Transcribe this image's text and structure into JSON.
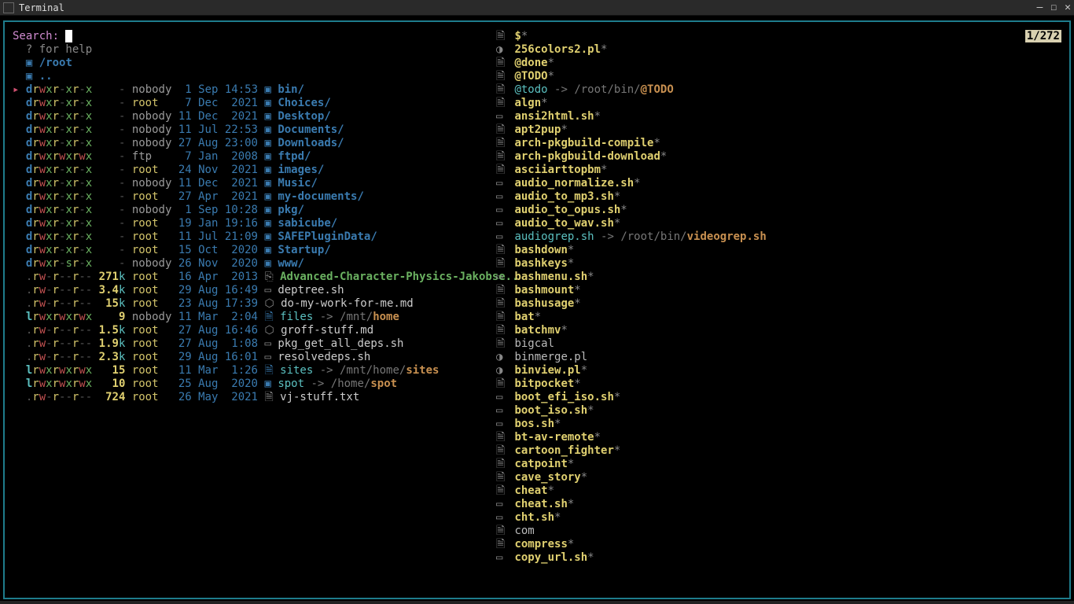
{
  "window": {
    "title": "Terminal"
  },
  "counter": "1/272",
  "search": {
    "label": "Search:",
    "help": "  ? for help"
  },
  "path": {
    "icon": "▣",
    "root": "/root",
    "up": ".."
  },
  "left_rows": [
    {
      "sel": true,
      "perm": "drwxr-xr-x",
      "size": "-",
      "user": "nobody",
      "date": " 1 Sep 14:53",
      "icon": "▣",
      "name": "bin/",
      "type": "dir"
    },
    {
      "sel": false,
      "perm": "drwxr-xr-x",
      "size": "-",
      "user": "root",
      "date": " 7 Dec  2021",
      "icon": "▣",
      "name": "Choices/",
      "type": "dir"
    },
    {
      "sel": false,
      "perm": "drwxr-xr-x",
      "size": "-",
      "user": "nobody",
      "date": "11 Dec  2021",
      "icon": "▣",
      "name": "Desktop/",
      "type": "dir"
    },
    {
      "sel": false,
      "perm": "drwxr-xr-x",
      "size": "-",
      "user": "nobody",
      "date": "11 Jul 22:53",
      "icon": "▣",
      "name": "Documents/",
      "type": "dir"
    },
    {
      "sel": false,
      "perm": "drwxr-xr-x",
      "size": "-",
      "user": "nobody",
      "date": "27 Aug 23:00",
      "icon": "▣",
      "name": "Downloads/",
      "type": "dir"
    },
    {
      "sel": false,
      "perm": "drwxrwxrwx",
      "size": "-",
      "user": "ftp",
      "date": " 7 Jan  2008",
      "icon": "▣",
      "name": "ftpd/",
      "type": "dir"
    },
    {
      "sel": false,
      "perm": "drwxr-xr-x",
      "size": "-",
      "user": "root",
      "date": "24 Nov  2021",
      "icon": "▣",
      "name": "images/",
      "type": "dir"
    },
    {
      "sel": false,
      "perm": "drwxr-xr-x",
      "size": "-",
      "user": "nobody",
      "date": "11 Dec  2021",
      "icon": "▣",
      "name": "Music/",
      "type": "dir"
    },
    {
      "sel": false,
      "perm": "drwxr-xr-x",
      "size": "-",
      "user": "root",
      "date": "27 Apr  2021",
      "icon": "▣",
      "name": "my-documents/",
      "type": "dir"
    },
    {
      "sel": false,
      "perm": "drwxr-xr-x",
      "size": "-",
      "user": "nobody",
      "date": " 1 Sep 10:28",
      "icon": "▣",
      "name": "pkg/",
      "type": "dir"
    },
    {
      "sel": false,
      "perm": "drwxr-xr-x",
      "size": "-",
      "user": "root",
      "date": "19 Jan 19:16",
      "icon": "▣",
      "name": "sabicube/",
      "type": "dir"
    },
    {
      "sel": false,
      "perm": "drwxr-xr-x",
      "size": "-",
      "user": "root",
      "date": "11 Jul 21:09",
      "icon": "▣",
      "name": "SAFEPluginData/",
      "type": "dir"
    },
    {
      "sel": false,
      "perm": "drwxr-xr-x",
      "size": "-",
      "user": "root",
      "date": "15 Oct  2020",
      "icon": "▣",
      "name": "Startup/",
      "type": "dir"
    },
    {
      "sel": false,
      "perm": "drwxr-sr-x",
      "size": "-",
      "user": "nobody",
      "date": "26 Nov  2020",
      "icon": "▣",
      "name": "www/",
      "type": "dir"
    },
    {
      "sel": false,
      "perm": ".rw-r--r--",
      "size": "271k",
      "user": "root",
      "date": "16 Apr  2013",
      "icon": "⎘",
      "name": "Advanced-Character-Physics-Jakobse..",
      "type": "pdf"
    },
    {
      "sel": false,
      "perm": ".rw-r--r--",
      "size": "3.4k",
      "user": "root",
      "date": "29 Aug 16:49",
      "icon": "▭",
      "name": "deptree.sh",
      "type": "sh"
    },
    {
      "sel": false,
      "perm": ".rw-r--r--",
      "size": "15k",
      "user": "root",
      "date": "23 Aug 17:39",
      "icon": "⬡",
      "name": "do-my-work-for-me.md",
      "type": "md"
    },
    {
      "sel": false,
      "perm": "lrwxrwxrwx",
      "size": "9",
      "user": "nobody",
      "date": "11 Mar  2:04",
      "icon": "🗎",
      "name": "files",
      "type": "link",
      "arrow": "->",
      "target_pre": "/mnt/",
      "target_hl": "home"
    },
    {
      "sel": false,
      "perm": ".rw-r--r--",
      "size": "1.5k",
      "user": "root",
      "date": "27 Aug 16:46",
      "icon": "⬡",
      "name": "groff-stuff.md",
      "type": "md"
    },
    {
      "sel": false,
      "perm": ".rw-r--r--",
      "size": "1.9k",
      "user": "root",
      "date": "27 Aug  1:08",
      "icon": "▭",
      "name": "pkg_get_all_deps.sh",
      "type": "sh"
    },
    {
      "sel": false,
      "perm": ".rw-r--r--",
      "size": "2.3k",
      "user": "root",
      "date": "29 Aug 16:01",
      "icon": "▭",
      "name": "resolvedeps.sh",
      "type": "sh"
    },
    {
      "sel": false,
      "perm": "lrwxrwxrwx",
      "size": "15",
      "user": "root",
      "date": "11 Mar  1:26",
      "icon": "🗎",
      "name": "sites",
      "type": "link",
      "arrow": "->",
      "target_pre": "/mnt/home/",
      "target_hl": "sites"
    },
    {
      "sel": false,
      "perm": "lrwxrwxrwx",
      "size": "10",
      "user": "root",
      "date": "25 Aug  2020",
      "icon": "▣",
      "name": "spot",
      "type": "link",
      "arrow": "->",
      "target_pre": "/home/",
      "target_hl": "spot"
    },
    {
      "sel": false,
      "perm": ".rw-r--r--",
      "size": "724",
      "user": "root",
      "date": "26 May  2021",
      "icon": "🗎",
      "name": "vj-stuff.txt",
      "type": "txt"
    }
  ],
  "right_rows": [
    {
      "icon": "🗎",
      "name": "$",
      "star": "*",
      "style": "yellow"
    },
    {
      "icon": "◑",
      "name": "256colors2.pl",
      "star": "*",
      "style": "yellow"
    },
    {
      "icon": "🗎",
      "name": "@done",
      "star": "*",
      "style": "yellow"
    },
    {
      "icon": "🗎",
      "name": "@TODO",
      "star": "*",
      "style": "yellow"
    },
    {
      "icon": "🗎",
      "name": "@todo",
      "style": "cyan",
      "arrow": "->",
      "target_pre": "/root/bin/",
      "target_hl": "@TODO"
    },
    {
      "icon": "🗎",
      "name": "algn",
      "star": "*",
      "style": "yellow"
    },
    {
      "icon": "▭",
      "name": "ansi2html.sh",
      "star": "*",
      "style": "yellow"
    },
    {
      "icon": "🗎",
      "name": "apt2pup",
      "star": "*",
      "style": "yellow"
    },
    {
      "icon": "🗎",
      "name": "arch-pkgbuild-compile",
      "star": "*",
      "style": "yellow"
    },
    {
      "icon": "🗎",
      "name": "arch-pkgbuild-download",
      "star": "*",
      "style": "yellow"
    },
    {
      "icon": "🗎",
      "name": "asciiarttopbm",
      "star": "*",
      "style": "yellow"
    },
    {
      "icon": "▭",
      "name": "audio_normalize.sh",
      "star": "*",
      "style": "yellow"
    },
    {
      "icon": "▭",
      "name": "audio_to_mp3.sh",
      "star": "*",
      "style": "yellow"
    },
    {
      "icon": "▭",
      "name": "audio_to_opus.sh",
      "star": "*",
      "style": "yellow"
    },
    {
      "icon": "▭",
      "name": "audio_to_wav.sh",
      "star": "*",
      "style": "yellow"
    },
    {
      "icon": "▭",
      "name": "audiogrep.sh",
      "style": "cyan",
      "arrow": "->",
      "target_pre": "/root/bin/",
      "target_hl": "videogrep.sh"
    },
    {
      "icon": "🗎",
      "name": "bashdown",
      "star": "*",
      "style": "yellow"
    },
    {
      "icon": "🗎",
      "name": "bashkeys",
      "star": "*",
      "style": "yellow"
    },
    {
      "icon": "▭",
      "name": "bashmenu.sh",
      "star": "*",
      "style": "yellow"
    },
    {
      "icon": "🗎",
      "name": "bashmount",
      "star": "*",
      "style": "yellow"
    },
    {
      "icon": "🗎",
      "name": "bashusage",
      "star": "*",
      "style": "yellow"
    },
    {
      "icon": "🗎",
      "name": "bat",
      "star": "*",
      "style": "yellow"
    },
    {
      "icon": "🗎",
      "name": "batchmv",
      "star": "*",
      "style": "yellow"
    },
    {
      "icon": "🗎",
      "name": "bigcal",
      "style": "grey"
    },
    {
      "icon": "◑",
      "name": "binmerge.pl",
      "style": "grey"
    },
    {
      "icon": "◑",
      "name": "binview.pl",
      "star": "*",
      "style": "yellow"
    },
    {
      "icon": "🗎",
      "name": "bitpocket",
      "star": "*",
      "style": "yellow"
    },
    {
      "icon": "▭",
      "name": "boot_efi_iso.sh",
      "star": "*",
      "style": "yellow"
    },
    {
      "icon": "▭",
      "name": "boot_iso.sh",
      "star": "*",
      "style": "yellow"
    },
    {
      "icon": "▭",
      "name": "bos.sh",
      "star": "*",
      "style": "yellow"
    },
    {
      "icon": "🗎",
      "name": "bt-av-remote",
      "star": "*",
      "style": "yellow"
    },
    {
      "icon": "🗎",
      "name": "cartoon_fighter",
      "star": "*",
      "style": "yellow"
    },
    {
      "icon": "🗎",
      "name": "catpoint",
      "star": "*",
      "style": "yellow"
    },
    {
      "icon": "🗎",
      "name": "cave_story",
      "star": "*",
      "style": "yellow"
    },
    {
      "icon": "🗎",
      "name": "cheat",
      "star": "*",
      "style": "yellow"
    },
    {
      "icon": "▭",
      "name": "cheat.sh",
      "star": "*",
      "style": "yellow"
    },
    {
      "icon": "▭",
      "name": "cht.sh",
      "star": "*",
      "style": "yellow"
    },
    {
      "icon": "🗎",
      "name": "com",
      "style": "grey"
    },
    {
      "icon": "🗎",
      "name": "compress",
      "star": "*",
      "style": "yellow"
    },
    {
      "icon": "▭",
      "name": "copy_url.sh",
      "star": "*",
      "style": "yellow"
    }
  ]
}
